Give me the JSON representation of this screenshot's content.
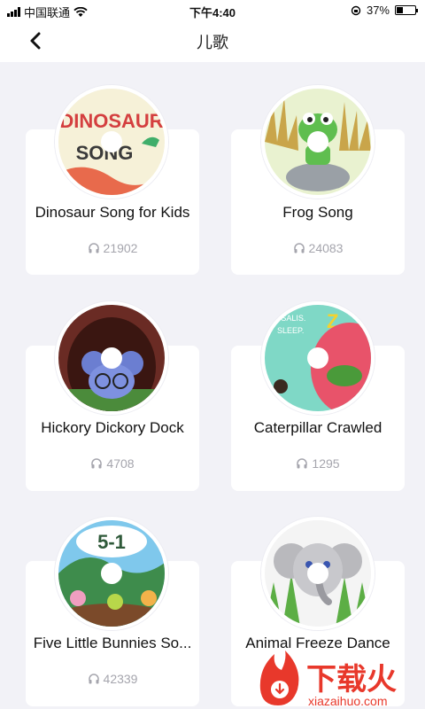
{
  "status_bar": {
    "carrier": "中国联通",
    "time": "下午4:40",
    "battery_percent": "37%",
    "battery_level": 0.37
  },
  "header": {
    "title": "儿歌",
    "back_icon": "chevron-left-icon"
  },
  "songs": [
    {
      "title": "Dinosaur Song for Kids",
      "plays": "21902",
      "cover_text_1": "DINOSAUR",
      "cover_text_2": "SONG"
    },
    {
      "title": "Frog Song",
      "plays": "24083"
    },
    {
      "title": "Hickory Dickory Dock",
      "plays": "4708"
    },
    {
      "title": "Caterpillar Crawled",
      "plays": "1295",
      "cover_text_1": "RYSALIS.",
      "cover_text_2": "SLEEP."
    },
    {
      "title": "Five Little Bunnies So...",
      "plays": "42339",
      "cover_text_1": "5-1"
    },
    {
      "title": "Animal Freeze Dance",
      "plays": ""
    }
  ],
  "watermark": {
    "text": "下载火",
    "url": "xiazaihuo.com"
  },
  "colors": {
    "background": "#f2f2f7",
    "card": "#ffffff",
    "muted_text": "#a5a5ad",
    "watermark_red": "#e8382b"
  }
}
